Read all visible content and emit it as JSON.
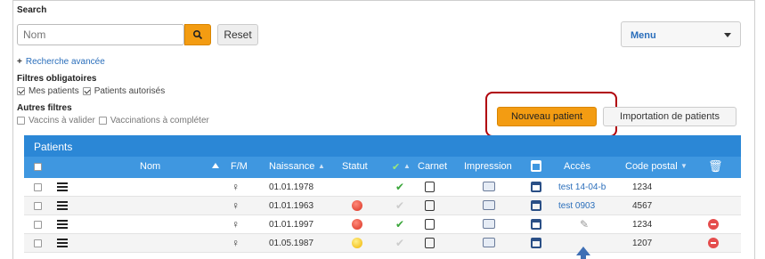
{
  "search": {
    "label": "Search",
    "placeholder": "Nom",
    "reset_label": "Reset"
  },
  "menu": {
    "label": "Menu"
  },
  "advanced_search": "Recherche avancée",
  "mandatory_filters": {
    "title": "Filtres obligatoires",
    "options": [
      {
        "label": "Mes patients",
        "checked": true
      },
      {
        "label": "Patients autorisés",
        "checked": true
      }
    ]
  },
  "other_filters": {
    "title": "Autres filtres",
    "options": [
      {
        "label": "Vaccins à valider",
        "checked": false
      },
      {
        "label": "Vaccinations à compléter",
        "checked": false
      }
    ]
  },
  "actions": {
    "new_patient": "Nouveau patient",
    "import_patients": "Importation de patients"
  },
  "panel": {
    "title": "Patients"
  },
  "columns": {
    "name": "Nom",
    "sex": "F/M",
    "birth": "Naissance",
    "status": "Statut",
    "carnet": "Carnet",
    "print": "Impression",
    "access": "Accès",
    "postal": "Code postal"
  },
  "rows": [
    {
      "birth": "01.01.1978",
      "status": "",
      "validated": true,
      "access": "test 14-04-b",
      "postal": "1234",
      "deletable": false
    },
    {
      "birth": "01.01.1963",
      "status": "red",
      "validated": false,
      "access": "test 0903",
      "postal": "4567",
      "deletable": false
    },
    {
      "birth": "01.01.1997",
      "status": "red",
      "validated": true,
      "access": "",
      "postal": "1234",
      "deletable": true
    },
    {
      "birth": "01.05.1987",
      "status": "yellow",
      "validated": false,
      "access": "",
      "postal": "1207",
      "deletable": true
    }
  ],
  "colors": {
    "accent_orange": "#f39c12",
    "header_blue": "#2b87d6",
    "highlight_red": "#b0000a",
    "link_blue": "#2a6ebb"
  }
}
